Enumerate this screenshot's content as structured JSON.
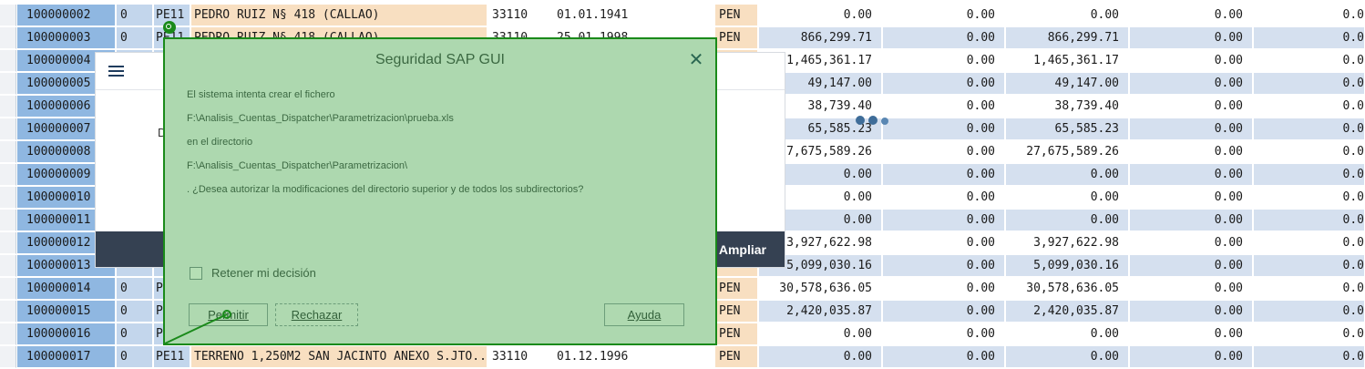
{
  "table": {
    "rows": [
      {
        "account": "100000002",
        "z": "0",
        "soc": "PE11",
        "name": "PEDRO RUIZ N§ 418 (CALLAO)",
        "cta": "33110",
        "date": "01.01.1941",
        "cur": "PEN",
        "n1": "0.00",
        "n2": "0.00",
        "n3": "0.00",
        "n4": "0.00",
        "n5": "0.0"
      },
      {
        "account": "100000003",
        "z": "0",
        "soc": "PE11",
        "name": "PEDRO RUIZ N§ 418 (CALLAO)",
        "cta": "33110",
        "date": "25.01.1998",
        "cur": "PEN",
        "n1": "866,299.71",
        "n2": "0.00",
        "n3": "866,299.71",
        "n4": "0.00",
        "n5": "0.0"
      },
      {
        "account": "100000004",
        "z": "",
        "soc": "",
        "name": "",
        "cta": "",
        "date": "",
        "cur": "",
        "n1": "1,465,361.17",
        "n2": "0.00",
        "n3": "1,465,361.17",
        "n4": "0.00",
        "n5": "0.0"
      },
      {
        "account": "100000005",
        "z": "",
        "soc": "",
        "name": "",
        "cta": "",
        "date": "",
        "cur": "",
        "n1": "49,147.00",
        "n2": "0.00",
        "n3": "49,147.00",
        "n4": "0.00",
        "n5": "0.0"
      },
      {
        "account": "100000006",
        "z": "",
        "soc": "",
        "name": "",
        "cta": "",
        "date": "",
        "cur": "",
        "n1": "38,739.40",
        "n2": "0.00",
        "n3": "38,739.40",
        "n4": "0.00",
        "n5": "0.0"
      },
      {
        "account": "100000007",
        "z": "",
        "soc": "",
        "name": "",
        "cta": "",
        "date": "",
        "cur": "",
        "n1": "65,585.23",
        "n2": "0.00",
        "n3": "65,585.23",
        "n4": "0.00",
        "n5": "0.0"
      },
      {
        "account": "100000008",
        "z": "",
        "soc": "",
        "name": "",
        "cta": "",
        "date": "",
        "cur": "",
        "n1": "27,675,589.26",
        "n2": "0.00",
        "n3": "27,675,589.26",
        "n4": "0.00",
        "n5": "0.0"
      },
      {
        "account": "100000009",
        "z": "",
        "soc": "",
        "name": "",
        "cta": "",
        "date": "",
        "cur": "",
        "n1": "0.00",
        "n2": "0.00",
        "n3": "0.00",
        "n4": "0.00",
        "n5": "0.0"
      },
      {
        "account": "100000010",
        "z": "",
        "soc": "",
        "name": "",
        "cta": "",
        "date": "",
        "cur": "",
        "n1": "0.00",
        "n2": "0.00",
        "n3": "0.00",
        "n4": "0.00",
        "n5": "0.0"
      },
      {
        "account": "100000011",
        "z": "",
        "soc": "",
        "name": "",
        "cta": "",
        "date": "",
        "cur": "",
        "n1": "0.00",
        "n2": "0.00",
        "n3": "0.00",
        "n4": "0.00",
        "n5": "0.0"
      },
      {
        "account": "100000012",
        "z": "",
        "soc": "",
        "name": "",
        "cta": "",
        "date": "",
        "cur": "",
        "n1": "3,927,622.98",
        "n2": "0.00",
        "n3": "3,927,622.98",
        "n4": "0.00",
        "n5": "0.0"
      },
      {
        "account": "100000013",
        "z": "",
        "soc": "",
        "name": "",
        "cta": "",
        "date": "",
        "cur": "",
        "n1": "5,099,030.16",
        "n2": "0.00",
        "n3": "5,099,030.16",
        "n4": "0.00",
        "n5": "0.0"
      },
      {
        "account": "100000014",
        "z": "0",
        "soc": "P",
        "name": "",
        "cta": "",
        "date": "",
        "cur": "PEN",
        "n1": "30,578,636.05",
        "n2": "0.00",
        "n3": "30,578,636.05",
        "n4": "0.00",
        "n5": "0.0"
      },
      {
        "account": "100000015",
        "z": "0",
        "soc": "P",
        "name": "",
        "cta": "",
        "date": "",
        "cur": "PEN",
        "n1": "2,420,035.87",
        "n2": "0.00",
        "n3": "2,420,035.87",
        "n4": "0.00",
        "n5": "0.0"
      },
      {
        "account": "100000016",
        "z": "0",
        "soc": "P",
        "name": "",
        "cta": "",
        "date": "",
        "cur": "PEN",
        "n1": "0.00",
        "n2": "0.00",
        "n3": "0.00",
        "n4": "0.00",
        "n5": "0.0"
      },
      {
        "account": "100000017",
        "z": "0",
        "soc": "PE11",
        "name": "TERRENO 1,250M2 SAN JACINTO ANEXO S.JTO...",
        "cta": "33110",
        "date": "01.12.1996",
        "cur": "PEN",
        "n1": "0.00",
        "n2": "0.00",
        "n3": "0.00",
        "n4": "0.00",
        "n5": "0.0"
      }
    ]
  },
  "loading_popup": {
    "menu_icon": "menu-icon",
    "letter": "D",
    "footer_button": "Ampliar"
  },
  "dialog": {
    "title": "Seguridad SAP GUI",
    "close_icon": "close-icon",
    "lines": [
      "El sistema intenta crear el fichero",
      "F:\\Analisis_Cuentas_Dispatcher\\Parametrizacion\\prueba.xls",
      "en el directorio",
      "F:\\Analisis_Cuentas_Dispatcher\\Parametrizacion\\",
      ". ¿Desea autorizar la modificaciones del directorio superior y de todos los subdirectorios?"
    ],
    "checkbox_label": "Retener mi decisión",
    "buttons": {
      "allow": "Permitir",
      "reject": "Rechazar",
      "help": "Ayuda"
    }
  },
  "colors": {
    "account_col": "#8fb7e1",
    "name_col": "#f8dfc1",
    "overlay_green": "#1a8a1a"
  }
}
